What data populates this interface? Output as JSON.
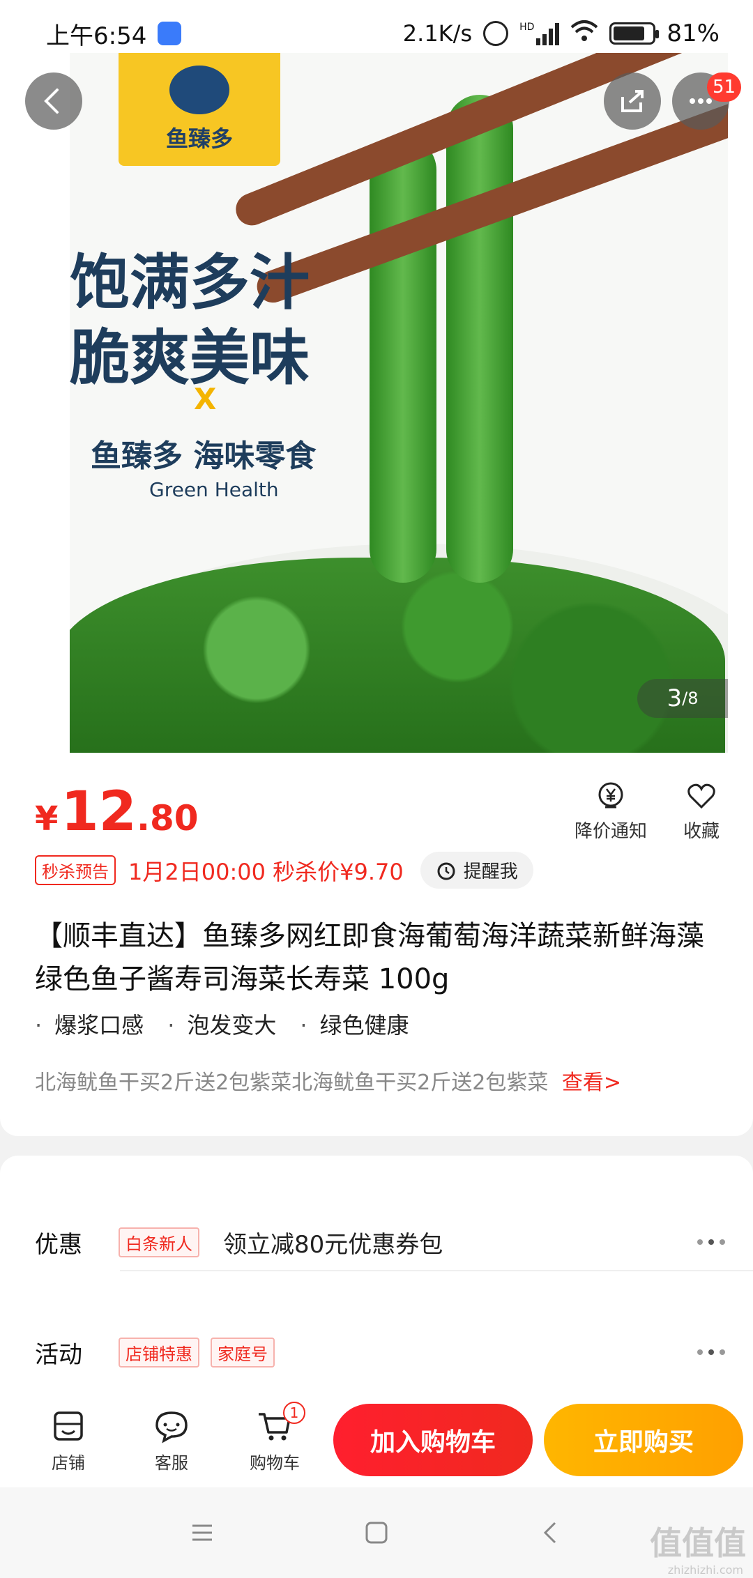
{
  "status_bar": {
    "time": "上午6:54",
    "net_speed": "2.1K/s",
    "signal_label": "HD",
    "battery": "81%",
    "battery_level": 0.81
  },
  "header": {
    "back_icon": "chevron-left-icon",
    "share_icon": "share-icon",
    "more_icon": "more-horizontal-icon",
    "message_count": "51"
  },
  "hero": {
    "brand": "鱼臻多",
    "slogan_line1": "饱满多汁",
    "slogan_line2": "脆爽美味",
    "cross": "X",
    "subtitle": "鱼臻多 海味零食",
    "english": "Green Health",
    "image_index": "3",
    "image_total": "/8",
    "colors": {
      "brand_yellow": "#f7c623",
      "slogan_navy": "#1e3d5c",
      "seaweed_green": "#3d8f2c"
    }
  },
  "product": {
    "price_symbol": "¥",
    "price_int": "12",
    "price_dec": ".80",
    "actions": [
      {
        "label": "降价通知",
        "icon": "yen-bell-icon"
      },
      {
        "label": "收藏",
        "icon": "heart-icon"
      }
    ],
    "flash_tag": "秒杀预告",
    "flash_text": "1月2日00:00 秒杀价¥9.70",
    "remind_label": "提醒我",
    "title": "【顺丰直达】鱼臻多网红即食海葡萄海洋蔬菜新鲜海藻绿色鱼子酱寿司海菜长寿菜 100g",
    "features": [
      "爆浆口感",
      "泡发变大",
      "绿色健康"
    ],
    "promo_text": "北海鱿鱼干买2斤送2包紫菜北海鱿鱼干买2斤送2包紫菜",
    "promo_link": "查看>",
    "accent_color": "#f0291f"
  },
  "offers": {
    "discount_label": "优惠",
    "discount_tag": "白条新人",
    "discount_text": "领立减80元优惠券包",
    "activity_label": "活动",
    "activity_tags": [
      "店铺特惠",
      "家庭号"
    ]
  },
  "action_bar": {
    "store_label": "店铺",
    "service_label": "客服",
    "cart_label": "购物车",
    "cart_count": "1",
    "add_cart_label": "加入购物车",
    "buy_label": "立即购买"
  },
  "watermark": {
    "main": "值值值",
    "sub": "zhizhizhi.com"
  }
}
